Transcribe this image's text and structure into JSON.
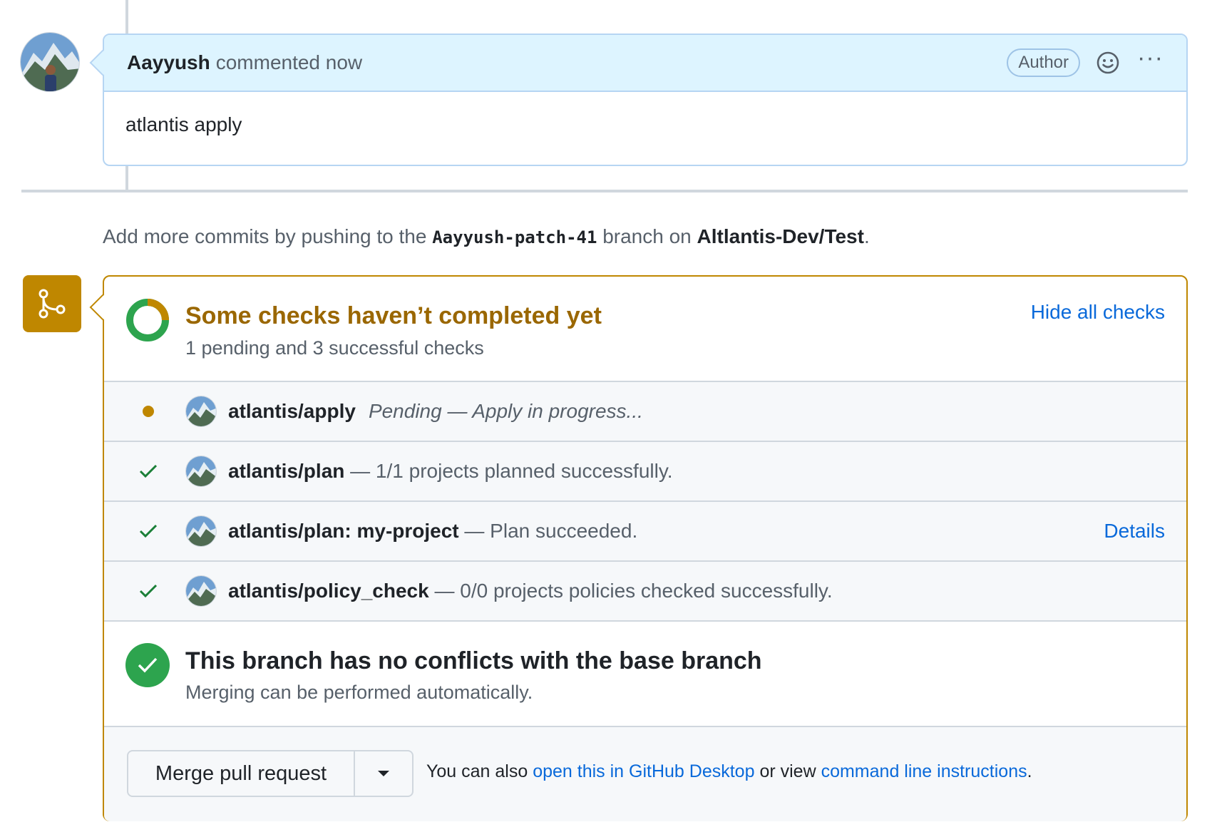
{
  "comment": {
    "author": "Aayyush",
    "time": "commented now",
    "badge": "Author",
    "body": "atlantis apply"
  },
  "push_hint": {
    "prefix": "Add more commits by pushing to the",
    "branch": "Aayyush-patch-41",
    "middle": "branch on",
    "repo": "Altlantis-Dev/Test",
    "suffix": "."
  },
  "checks": {
    "title": "Some checks haven’t completed yet",
    "subtitle": "1 pending and 3 successful checks",
    "hide_label": "Hide all checks",
    "items": [
      {
        "status": "pending",
        "name": "atlantis/apply",
        "desc": "Pending — Apply in progress..."
      },
      {
        "status": "success",
        "name": "atlantis/plan",
        "desc": " — 1/1 projects planned successfully."
      },
      {
        "status": "success",
        "name": "atlantis/plan: my-project",
        "desc": " — Plan succeeded.",
        "link": "Details"
      },
      {
        "status": "success",
        "name": "atlantis/policy_check",
        "desc": " — 0/0 projects policies checked successfully."
      }
    ]
  },
  "conflicts": {
    "title": "This branch has no conflicts with the base branch",
    "subtitle": "Merging can be performed automatically."
  },
  "merge": {
    "button": "Merge pull request",
    "text_prefix": "You can also",
    "link_desktop": "open this in GitHub Desktop",
    "text_middle": "or view",
    "link_cli": "command line instructions",
    "text_suffix": "."
  },
  "colors": {
    "pending": "#bf8700",
    "success": "#2da44e",
    "link": "#0969da"
  }
}
